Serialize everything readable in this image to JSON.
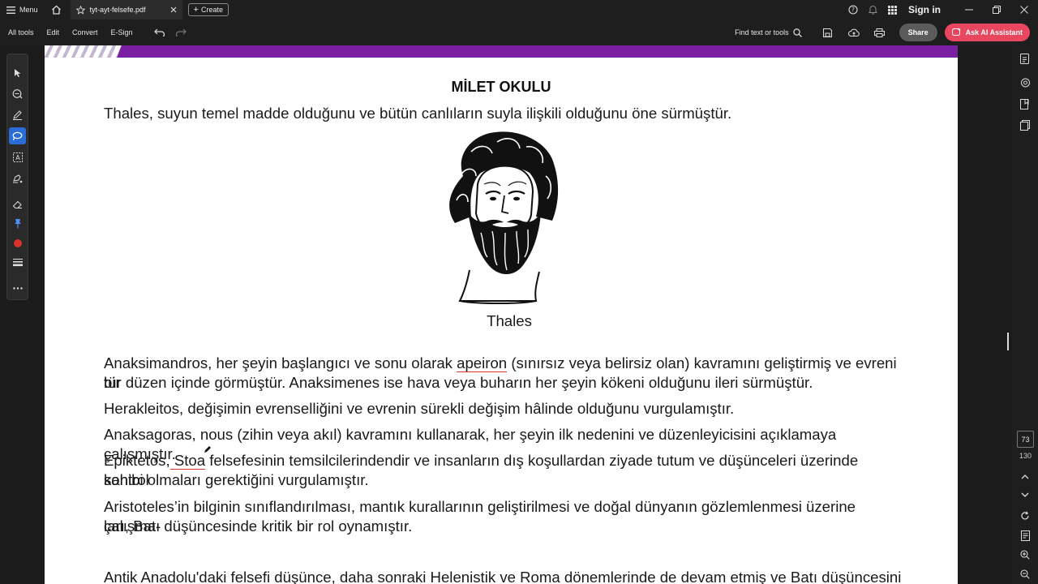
{
  "titlebar": {
    "menu_label": "Menu",
    "tab_name": "tyt-ayt-felsefe.pdf",
    "create_label": "Create",
    "sign_in": "Sign in"
  },
  "toolbar": {
    "items": [
      "All tools",
      "Edit",
      "Convert",
      "E-Sign"
    ],
    "find_label": "Find text or tools",
    "share_label": "Share",
    "ai_label": "Ask AI Assistant"
  },
  "document": {
    "title": "MİLET OKULU",
    "intro": "Thales, suyun temel madde olduğunu ve bütün canlıların suyla ilişkili olduğunu öne sürmüştür.",
    "caption": "Thales",
    "p1_line1_a": "Anaksimandros, her şeyin başlangıcı ve sonu olarak ",
    "p1_line1_ul": "apeiron",
    "p1_line1_b": " (sınırsız veya belirsiz olan) kavramını geliştirmiş ve evreni bir",
    "p1_line2": "tür düzen içinde görmüştür. Anaksimenes ise hava veya buharın her şeyin kökeni olduğunu ileri sürmüştür.",
    "p2": "Herakleitos, değişimin evrenselliğini ve evrenin sürekli değişim hâlinde olduğunu vurgulamıştır.",
    "p3": "Anaksagoras, nous (zihin veya akıl) kavramını kullanarak, her şeyin ilk nedenini ve düzenleyicisini açıklamaya çalışmıştır.",
    "p4_line1_a": "Epiktetos,",
    "p4_line1_ul": " Stoa",
    "p4_line1_b": " felsefesinin temsilcilerindendir ve insanların dış koşullardan ziyade tutum ve düşünceleri üzerinde kontrol",
    "p4_line2": "sahibi olmaları gerektiğini vurgulamıştır.",
    "p5_line1": "Aristoteles’in bilginin sınıflandırılması, mantık kurallarının geliştirilmesi ve doğal dünyanın gözlemlenmesi üzerine çalışma-",
    "p5_line2": "ları, Batı düşüncesinde kritik bir rol oynamıştır.",
    "p6_line1": "Antik Anadolu'daki felsefi düşünce, daha sonraki Helenistik ve Roma dönemlerinde de devam etmiş ve Batı düşüncesini"
  },
  "pagenav": {
    "current": "73",
    "total": "130"
  },
  "colors": {
    "banner": "#7b1fa2",
    "active_tool": "#2a6dd9",
    "ai_button": "#e8475f",
    "underline": "#d9332b"
  }
}
